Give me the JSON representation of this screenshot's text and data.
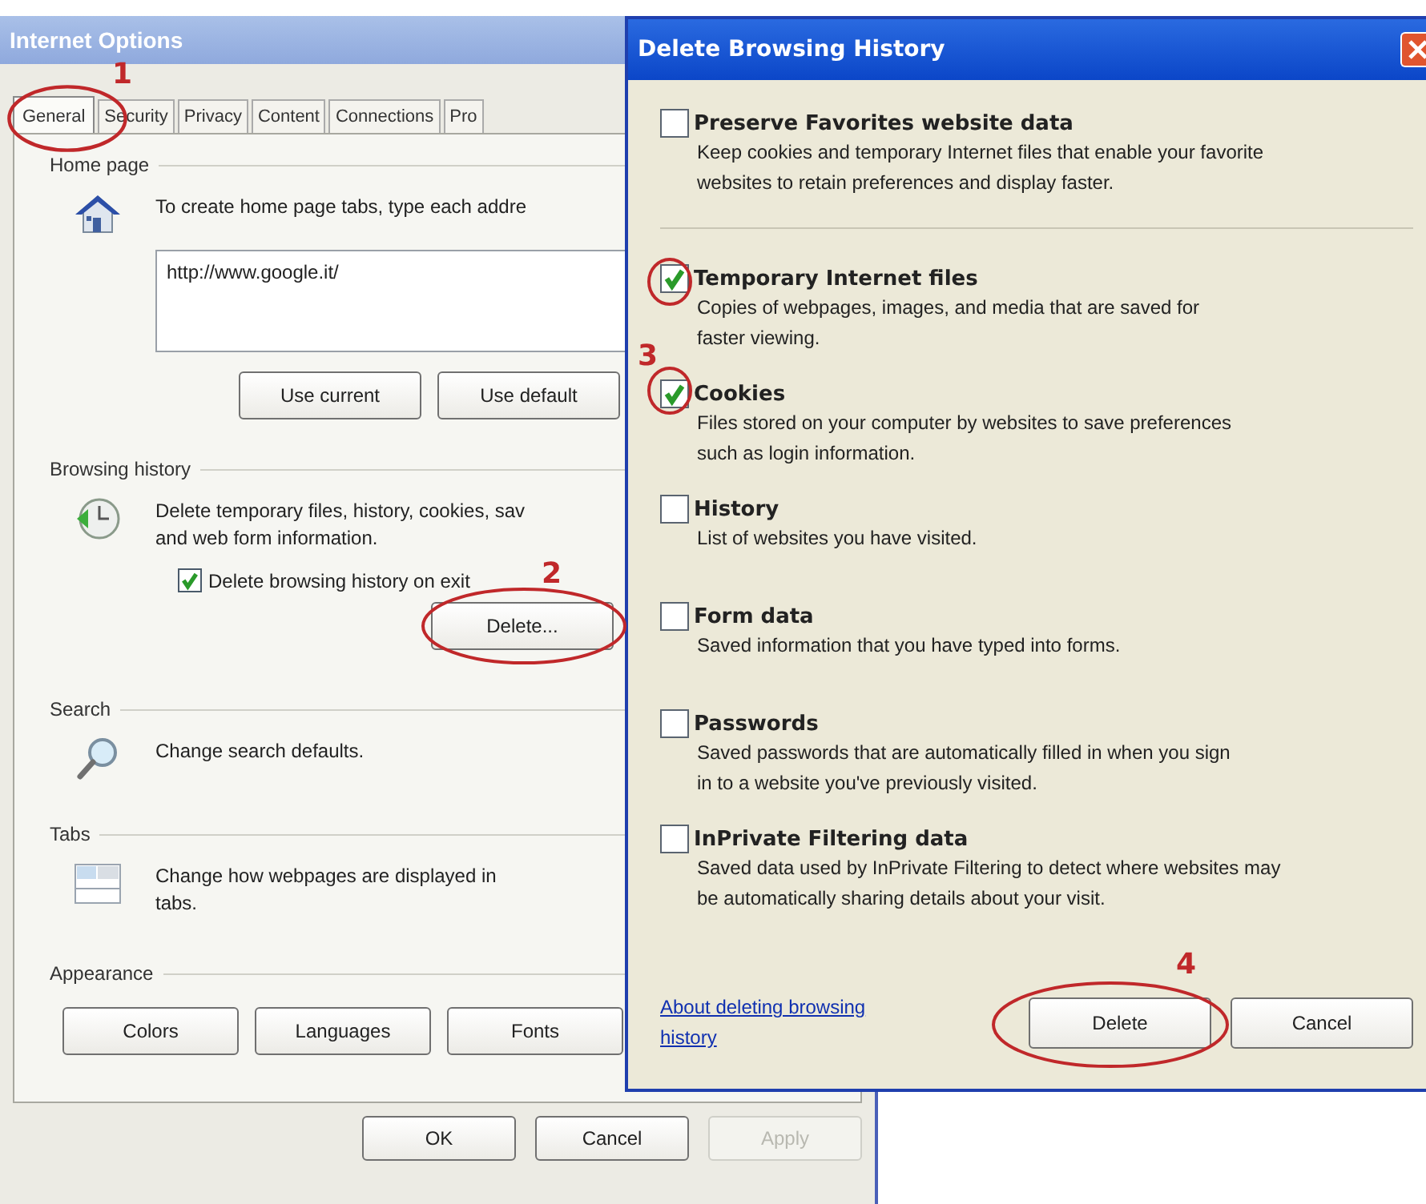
{
  "internet_options": {
    "title": "Internet Options",
    "tabs": [
      {
        "label": "General",
        "selected": true
      },
      {
        "label": "Security",
        "selected": false
      },
      {
        "label": "Privacy",
        "selected": false
      },
      {
        "label": "Content",
        "selected": false
      },
      {
        "label": "Connections",
        "selected": false
      },
      {
        "label": "Pro",
        "selected": false
      }
    ],
    "home_page": {
      "heading": "Home page",
      "description": "To create home page tabs, type each addre",
      "url": "http://www.google.it/",
      "buttons": [
        "Use current",
        "Use default"
      ]
    },
    "browsing_history": {
      "heading": "Browsing history",
      "description_lines": [
        "Delete temporary files, history, cookies, sav",
        "and web form information."
      ],
      "exit_checkbox": {
        "label": "Delete browsing history on exit",
        "checked": true
      },
      "button": "Delete..."
    },
    "search": {
      "heading": "Search",
      "description": "Change search defaults."
    },
    "tabs_section": {
      "heading": "Tabs",
      "description_lines": [
        "Change how webpages are displayed in",
        "tabs."
      ]
    },
    "appearance": {
      "heading": "Appearance",
      "buttons": [
        "Colors",
        "Languages",
        "Fonts"
      ]
    },
    "footer_buttons": [
      {
        "label": "OK",
        "disabled": false
      },
      {
        "label": "Cancel",
        "disabled": false
      },
      {
        "label": "Apply",
        "disabled": true
      }
    ]
  },
  "delete_dialog": {
    "title": "Delete Browsing History",
    "items": [
      {
        "title": "Preserve Favorites website data",
        "description_lines": [
          "Keep cookies and temporary Internet files that enable your favorite",
          "websites to retain preferences and display faster."
        ],
        "checked": false
      },
      {
        "title": "Temporary Internet files",
        "description_lines": [
          "Copies of webpages, images, and media that are saved for",
          "faster viewing."
        ],
        "checked": true
      },
      {
        "title": "Cookies",
        "description_lines": [
          "Files stored on your computer by websites to save preferences",
          "such as login information."
        ],
        "checked": true
      },
      {
        "title": "History",
        "description_lines": [
          "List of websites you have visited."
        ],
        "checked": false
      },
      {
        "title": "Form data",
        "description_lines": [
          "Saved information that you have typed into forms."
        ],
        "checked": false
      },
      {
        "title": "Passwords",
        "description_lines": [
          "Saved passwords that are automatically filled in when you sign",
          "in to a website you've previously visited."
        ],
        "checked": false
      },
      {
        "title": "InPrivate Filtering data",
        "description_lines": [
          "Saved data used by InPrivate Filtering to detect where websites may",
          "be automatically sharing details about your visit."
        ],
        "checked": false
      }
    ],
    "link_lines": [
      "About deleting browsing",
      "history"
    ],
    "buttons": [
      "Delete",
      "Cancel"
    ]
  },
  "annotations": [
    {
      "label": "1"
    },
    {
      "label": "2"
    },
    {
      "label": "3"
    },
    {
      "label": "4"
    }
  ]
}
